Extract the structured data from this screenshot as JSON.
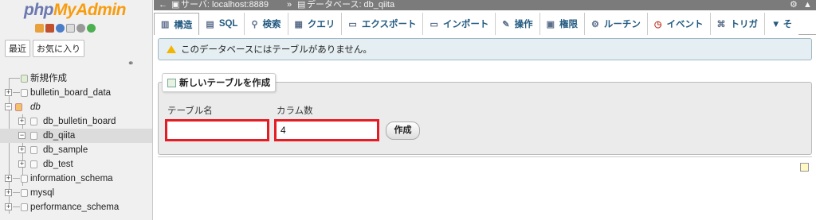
{
  "logo": {
    "part1": "php",
    "part2": "MyAdmin"
  },
  "sidebar": {
    "tabs": [
      "最近",
      "お気に入り"
    ],
    "tree": [
      {
        "label": "新規作成"
      },
      {
        "label": "bulletin_board_data"
      },
      {
        "label": "db"
      },
      {
        "label": "db_bulletin_board"
      },
      {
        "label": "db_qiita"
      },
      {
        "label": "db_sample"
      },
      {
        "label": "db_test"
      },
      {
        "label": "information_schema"
      },
      {
        "label": "mysql"
      },
      {
        "label": "performance_schema"
      }
    ]
  },
  "topbar": {
    "server": "サーバ: localhost:8889",
    "separator": "»",
    "database": "データベース: db_qiita"
  },
  "navtabs": [
    {
      "label": "構造",
      "icon": "structure-icon"
    },
    {
      "label": "SQL",
      "icon": "sql-icon"
    },
    {
      "label": "検索",
      "icon": "search-icon"
    },
    {
      "label": "クエリ",
      "icon": "query-icon"
    },
    {
      "label": "エクスポート",
      "icon": "export-icon"
    },
    {
      "label": "インポート",
      "icon": "import-icon"
    },
    {
      "label": "操作",
      "icon": "operations-icon"
    },
    {
      "label": "権限",
      "icon": "privileges-icon"
    },
    {
      "label": "ルーチン",
      "icon": "routines-icon"
    },
    {
      "label": "イベント",
      "icon": "events-icon"
    },
    {
      "label": "トリガ",
      "icon": "triggers-icon"
    },
    {
      "label": "▼ そ",
      "icon": "more-icon"
    }
  ],
  "notice": {
    "text": "このデータベースにはテーブルがありません。"
  },
  "create_table": {
    "legend": "新しいテーブルを作成",
    "name_label": "テーブル名",
    "name_value": "",
    "columns_label": "カラム数",
    "columns_value": "4",
    "button": "作成"
  }
}
